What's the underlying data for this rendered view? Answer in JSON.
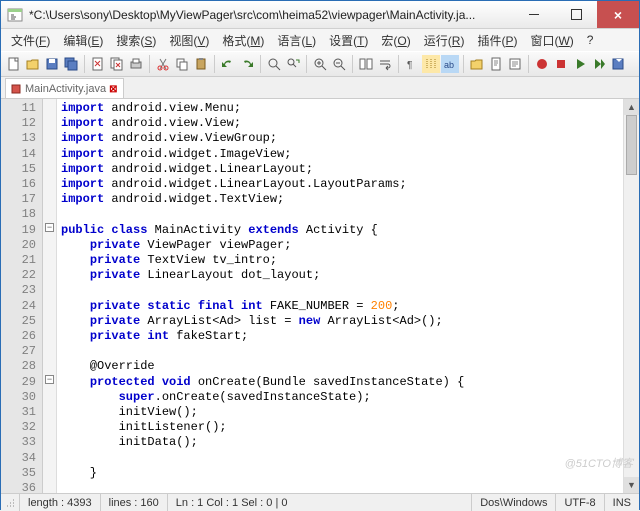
{
  "title": "*C:\\Users\\sony\\Desktop\\MyViewPager\\src\\com\\heima52\\viewpager\\MainActivity.ja...",
  "menu": [
    "文件(F)",
    "编辑(E)",
    "搜索(S)",
    "视图(V)",
    "格式(M)",
    "语言(L)",
    "设置(T)",
    "宏(O)",
    "运行(R)",
    "插件(P)",
    "窗口(W)",
    "?"
  ],
  "tab": {
    "label": "MainActivity.java"
  },
  "lines": [
    11,
    12,
    13,
    14,
    15,
    16,
    17,
    18,
    19,
    20,
    21,
    22,
    23,
    24,
    25,
    26,
    27,
    28,
    29,
    30,
    31,
    32,
    33,
    34,
    35,
    36
  ],
  "code": [
    [
      [
        "kw",
        "import"
      ],
      [
        "pl",
        " android.view.Menu;"
      ]
    ],
    [
      [
        "kw",
        "import"
      ],
      [
        "pl",
        " android.view.View;"
      ]
    ],
    [
      [
        "kw",
        "import"
      ],
      [
        "pl",
        " android.view.ViewGroup;"
      ]
    ],
    [
      [
        "kw",
        "import"
      ],
      [
        "pl",
        " android.widget.ImageView;"
      ]
    ],
    [
      [
        "kw",
        "import"
      ],
      [
        "pl",
        " android.widget.LinearLayout;"
      ]
    ],
    [
      [
        "kw",
        "import"
      ],
      [
        "pl",
        " android.widget.LinearLayout.LayoutParams;"
      ]
    ],
    [
      [
        "kw",
        "import"
      ],
      [
        "pl",
        " android.widget.TextView;"
      ]
    ],
    [],
    [
      [
        "kw",
        "public class"
      ],
      [
        "pl",
        " MainActivity "
      ],
      [
        "kw",
        "extends"
      ],
      [
        "pl",
        " Activity {"
      ]
    ],
    [
      [
        "pl",
        "    "
      ],
      [
        "kw",
        "private"
      ],
      [
        "pl",
        " ViewPager viewPager;"
      ]
    ],
    [
      [
        "pl",
        "    "
      ],
      [
        "kw",
        "private"
      ],
      [
        "pl",
        " TextView tv_intro;"
      ]
    ],
    [
      [
        "pl",
        "    "
      ],
      [
        "kw",
        "private"
      ],
      [
        "pl",
        " LinearLayout dot_layout;"
      ]
    ],
    [],
    [
      [
        "pl",
        "    "
      ],
      [
        "kw",
        "private static final int"
      ],
      [
        "pl",
        " FAKE_NUMBER = "
      ],
      [
        "num",
        "200"
      ],
      [
        "pl",
        ";"
      ]
    ],
    [
      [
        "pl",
        "    "
      ],
      [
        "kw",
        "private"
      ],
      [
        "pl",
        " ArrayList<Ad> list = "
      ],
      [
        "kw",
        "new"
      ],
      [
        "pl",
        " ArrayList<Ad>();"
      ]
    ],
    [
      [
        "pl",
        "    "
      ],
      [
        "kw",
        "private int"
      ],
      [
        "pl",
        " fakeStart;"
      ]
    ],
    [],
    [
      [
        "pl",
        "    @Override"
      ]
    ],
    [
      [
        "pl",
        "    "
      ],
      [
        "kw",
        "protected void"
      ],
      [
        "pl",
        " onCreate(Bundle savedInstanceState) {"
      ]
    ],
    [
      [
        "pl",
        "        "
      ],
      [
        "kw",
        "super"
      ],
      [
        "pl",
        ".onCreate(savedInstanceState);"
      ]
    ],
    [
      [
        "pl",
        "        initView();"
      ]
    ],
    [
      [
        "pl",
        "        initListener();"
      ]
    ],
    [
      [
        "pl",
        "        initData();"
      ]
    ],
    [],
    [
      [
        "pl",
        "    }"
      ]
    ],
    []
  ],
  "chart_data": {
    "type": "table",
    "title": "Java source lines 11-36",
    "series": [
      {
        "name": "line",
        "values": [
          11,
          12,
          13,
          14,
          15,
          16,
          17,
          18,
          19,
          20,
          21,
          22,
          23,
          24,
          25,
          26,
          27,
          28,
          29,
          30,
          31,
          32,
          33,
          34,
          35,
          36
        ]
      }
    ]
  },
  "status": {
    "length": "length : 4393",
    "lines": "lines : 160",
    "pos": "Ln : 1    Col : 1    Sel : 0 | 0",
    "eol": "Dos\\Windows",
    "enc": "UTF-8",
    "ins": "INS"
  },
  "watermark": "@51CTO博客"
}
